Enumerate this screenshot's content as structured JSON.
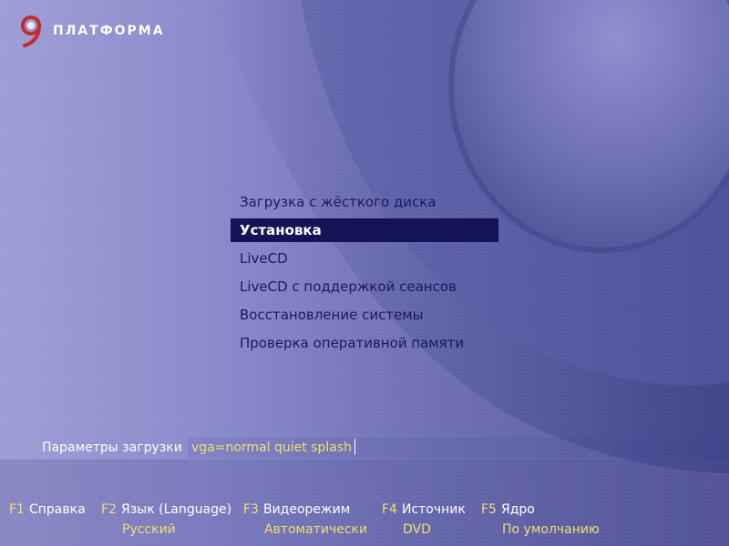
{
  "logo": {
    "text": "ПЛАТФОРМА",
    "digit": "9",
    "icon": "platform-9-logo-icon"
  },
  "menu": {
    "items": [
      {
        "label": "Загрузка с жёсткого диска",
        "selected": false
      },
      {
        "label": "Установка",
        "selected": true
      },
      {
        "label": "LiveCD",
        "selected": false
      },
      {
        "label": "LiveCD с поддержкой сеансов",
        "selected": false
      },
      {
        "label": "Восстановление системы",
        "selected": false
      },
      {
        "label": "Проверка оперативной памяти",
        "selected": false
      }
    ]
  },
  "boot_params": {
    "label": "Параметры загрузки",
    "value": "vga=normal quiet splash"
  },
  "function_keys": [
    {
      "key": "F1",
      "label": "Справка",
      "value": ""
    },
    {
      "key": "F2",
      "label": "Язык (Language)",
      "value": "Русский"
    },
    {
      "key": "F3",
      "label": "Видеорежим",
      "value": "Автоматически"
    },
    {
      "key": "F4",
      "label": "Источник",
      "value": "DVD"
    },
    {
      "key": "F5",
      "label": "Ядро",
      "value": "По умолчанию"
    }
  ],
  "colors": {
    "selection": "#141356",
    "menu_text": "#1a1a5c",
    "key_accent": "#f1de72",
    "white": "#ffffff",
    "logo_red": "#c62a2a"
  }
}
